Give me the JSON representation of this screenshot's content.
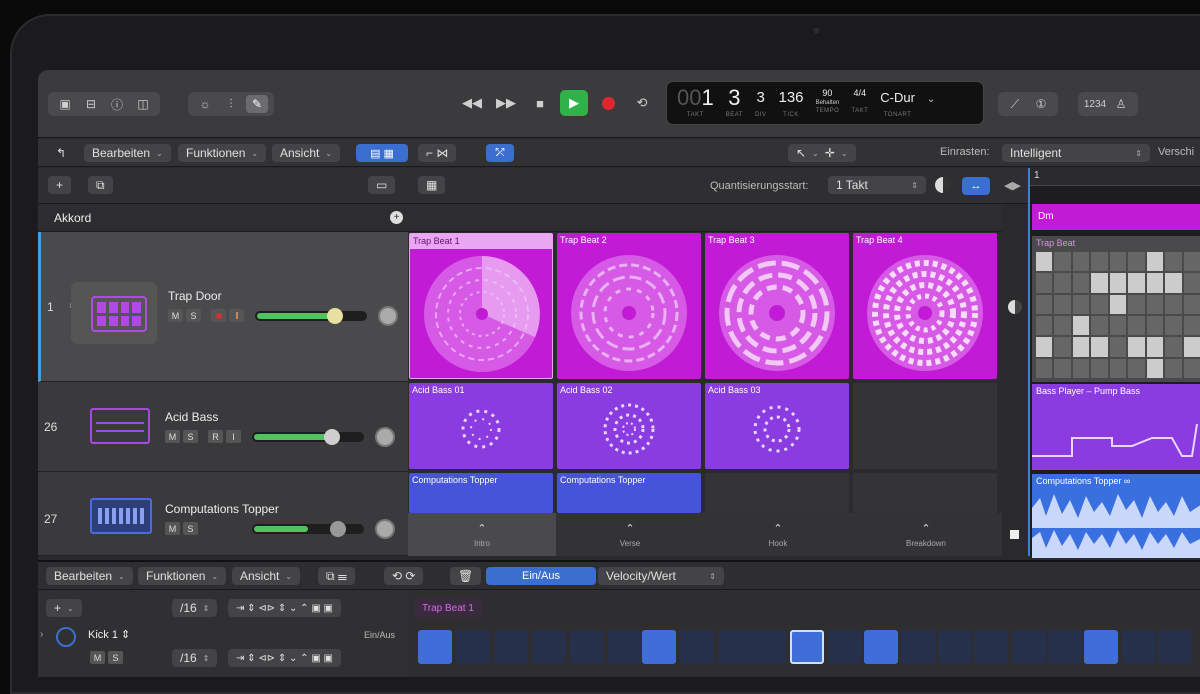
{
  "toolbar": {
    "transport": [
      "rewind",
      "fast-forward",
      "stop",
      "play",
      "record",
      "cycle"
    ]
  },
  "lcd": {
    "takt": "1",
    "beat": "3",
    "div": "3",
    "tick": "136",
    "takt_lead": "00",
    "tempo": "90",
    "tempo_sub": "Behalten",
    "sig_top": "4",
    "sig_bottom": "4",
    "key": "C-Dur",
    "labels": [
      "TAKT",
      "BEAT",
      "DIV",
      "TICK",
      "TEMPO",
      "TAKT",
      "TONART"
    ]
  },
  "menubar": {
    "edit": "Bearbeiten",
    "functions": "Funktionen",
    "view": "Ansicht",
    "snap_label": "Einrasten:",
    "snap_value": "Intelligent",
    "drag_label": "Verschi"
  },
  "quantize": {
    "label": "Quantisierungsstart:",
    "value": "1 Takt"
  },
  "chord_track": "Akkord",
  "tracks": [
    {
      "num": "1",
      "name": "Trap Door",
      "buttons": [
        "M",
        "S"
      ]
    },
    {
      "num": "26",
      "name": "Acid Bass",
      "buttons": [
        "M",
        "S",
        "R",
        "I"
      ]
    },
    {
      "num": "27",
      "name": "Computations Topper",
      "buttons": [
        "M",
        "S"
      ]
    }
  ],
  "cells": {
    "row1": [
      "Trap Beat 1",
      "Trap Beat 2",
      "Trap Beat 3",
      "Trap Beat 4"
    ],
    "row2": [
      "Acid Bass 01",
      "Acid Bass 02",
      "Acid Bass 03"
    ],
    "row3": [
      "Computations Topper",
      "Computations Topper"
    ]
  },
  "scenes": [
    "Intro",
    "Verse",
    "Hook",
    "Breakdown"
  ],
  "right_panel": {
    "ruler": "1",
    "chord": "Dm",
    "region1": "Trap Beat",
    "region2": "Bass Player – Pump Bass",
    "region3": "Computations Topper",
    "region3_loop": "∞"
  },
  "editor": {
    "edit": "Bearbeiten",
    "functions": "Funktionen",
    "view": "Ansicht",
    "toggle_on": "Ein/Aus",
    "toggle_velocity": "Velocity/Wert",
    "step_div": "/16",
    "region_name": "Trap Beat 1",
    "row_name": "Kick 1",
    "row_state": "Ein/Aus",
    "row_buttons": [
      "M",
      "S"
    ]
  },
  "colors": {
    "magenta": "#c21bd6",
    "purple": "#8a3ce0",
    "blue": "#4554d8",
    "accent_blue": "#3a6fd0",
    "green": "#2fb24a",
    "record": "#e0262e"
  }
}
